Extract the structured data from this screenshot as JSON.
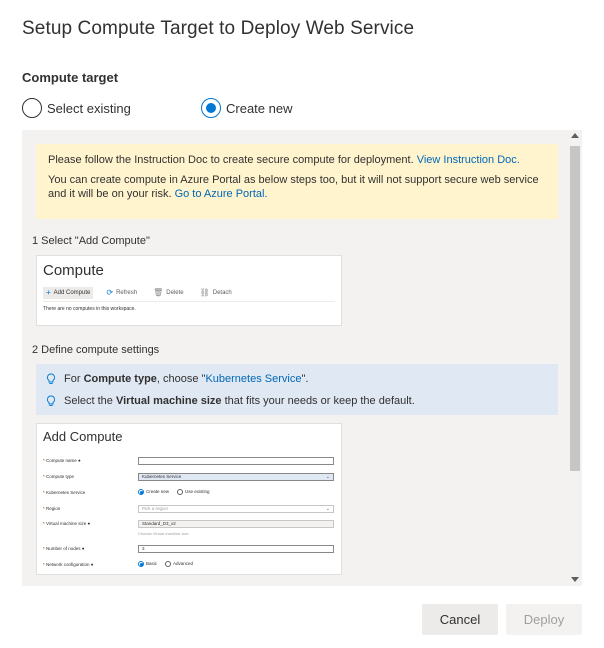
{
  "dialog": {
    "title": "Setup Compute Target to Deploy Web Service",
    "section_label": "Compute target",
    "options": [
      {
        "label": "Select existing",
        "selected": false
      },
      {
        "label": "Create new",
        "selected": true
      }
    ]
  },
  "warning": {
    "line1_text": "Please follow the Instruction Doc to create secure compute for deployment.",
    "line1_link": "View Instruction Doc.",
    "line2_text": "You can create compute in Azure Portal as below steps too, but it will not support secure web service and it will be on your risk.",
    "line2_link": "Go to Azure Portal."
  },
  "step1": {
    "title": "1 Select \"Add Compute\"",
    "card_title": "Compute",
    "toolbar": [
      "Add Compute",
      "Refresh",
      "Delete",
      "Detach"
    ],
    "note": "There are no computes in this workspace."
  },
  "step2": {
    "title": "2 Define compute settings",
    "tip1_prefix": "For ",
    "tip1_bold": "Compute type",
    "tip1_mid": ", choose \"",
    "tip1_link": "Kubernetes Service",
    "tip1_suffix": "\".",
    "tip2_prefix": "Select the ",
    "tip2_bold": "Virtual machine size",
    "tip2_suffix": " that fits your needs or keep the default."
  },
  "add_compute": {
    "title": "Add Compute",
    "compute_name_label": "Compute name",
    "compute_type_label": "Compute type",
    "compute_type_value": "Kubernetes Service",
    "k8s_label": "Kubernetes Service",
    "k8s_opt1": "Create new",
    "k8s_opt2": "Use existing",
    "region_label": "Region",
    "region_placeholder": "Pick a region",
    "vm_size_label": "Virtual machine size",
    "vm_size_value": "Standard_D3_v2",
    "vm_size_hint": "Choose Virtual machine size",
    "nodes_label": "Number of nodes",
    "nodes_value": "3",
    "network_label": "Network configuration",
    "network_opt1": "Basic",
    "network_opt2": "Advanced"
  },
  "footer": {
    "cancel": "Cancel",
    "deploy": "Deploy"
  },
  "colors": {
    "accent": "#0078d4",
    "warning_bg": "#fff4ce",
    "info_bg": "#dfe8f3"
  }
}
